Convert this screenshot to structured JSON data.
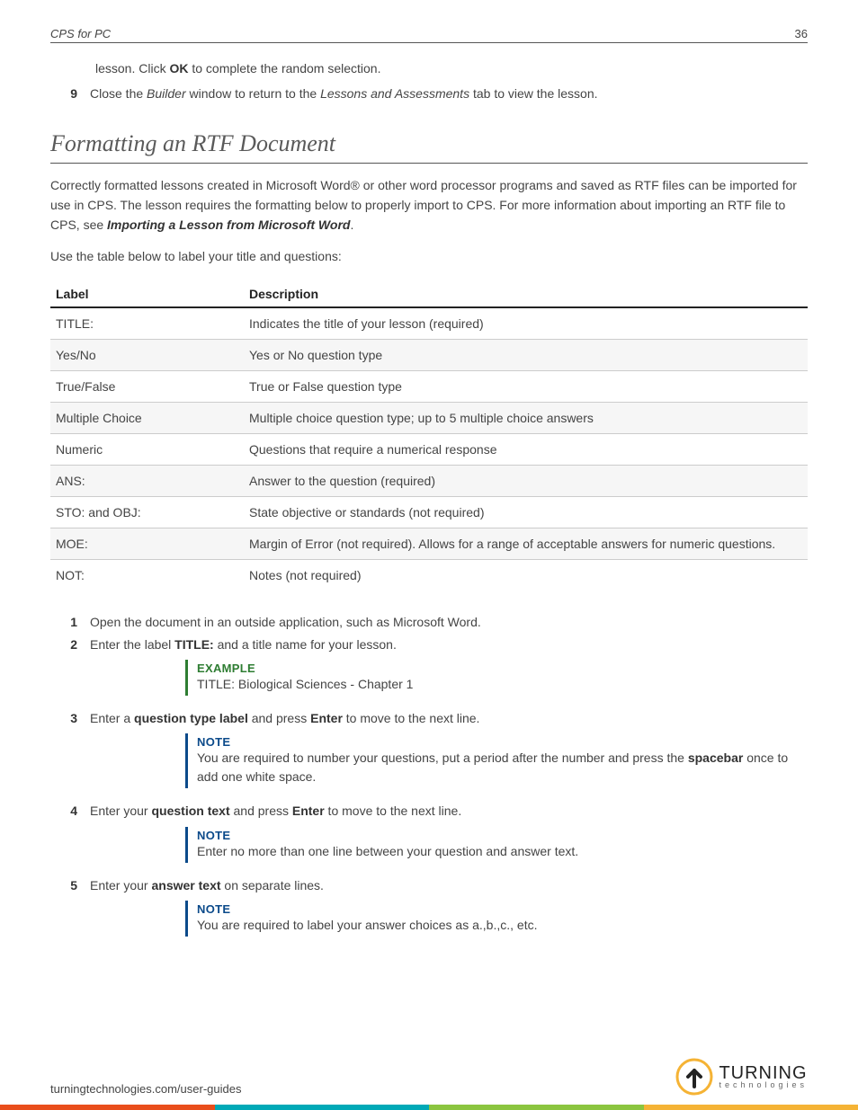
{
  "header": {
    "title": "CPS for PC",
    "page": "36"
  },
  "intro": {
    "cont_line": "lesson. Click <b>OK</b> to complete the random selection.",
    "step9_num": "9",
    "step9_body": "Close the <em class=\"i\">Builder</em> window to return to the <em class=\"i\">Lessons and Assessments</em> tab to view the lesson."
  },
  "section": {
    "heading": "Formatting an RTF Document",
    "p1": "Correctly formatted lessons created in Microsoft Word® or other word processor programs and saved as RTF files can be imported for use in CPS. The lesson requires the formatting below to properly import to CPS. For more information about importing an RTF file to CPS, see <b><em class=\"i\">Importing a Lesson from Microsoft Word</em></b>.",
    "p2": "Use the table below to label your title and questions:"
  },
  "table": {
    "head_label": "Label",
    "head_desc": "Description",
    "rows": [
      {
        "label": "TITLE:",
        "desc": "Indicates the title of your lesson (required)"
      },
      {
        "label": "Yes/No",
        "desc": "Yes or No question type"
      },
      {
        "label": "True/False",
        "desc": "True or False question type"
      },
      {
        "label": "Multiple Choice",
        "desc": "Multiple choice question type; up to 5 multiple choice answers"
      },
      {
        "label": "Numeric",
        "desc": "Questions that require a numerical response"
      },
      {
        "label": "ANS:",
        "desc": "Answer to the question (required)"
      },
      {
        "label": "STO: and OBJ:",
        "desc": "State objective or standards (not required)"
      },
      {
        "label": "MOE:",
        "desc": "Margin of Error (not required). Allows for a range of acceptable answers for numeric questions."
      },
      {
        "label": "NOT:",
        "desc": "Notes (not required)"
      }
    ]
  },
  "steps": [
    {
      "num": "1",
      "body": "Open the document in an outside application, such as Microsoft Word."
    },
    {
      "num": "2",
      "body": "Enter the label <b>TITLE:</b> and a title name for your lesson.",
      "callout": {
        "type": "example",
        "head": "EXAMPLE",
        "body": "TITLE: Biological Sciences - Chapter 1"
      }
    },
    {
      "num": "3",
      "body": "Enter a <b>question type label</b> and press <b>Enter</b> to move to the next line.",
      "callout": {
        "type": "note",
        "head": "NOTE",
        "body": "You are required to number your questions, put a period after the number and press the <b>spacebar</b> once to add one white space."
      }
    },
    {
      "num": "4",
      "body": "Enter your <b>question text</b> and press <b>Enter</b> to move to the next line.",
      "callout": {
        "type": "note",
        "head": "NOTE",
        "body": "Enter no more than one line between your question and answer text."
      }
    },
    {
      "num": "5",
      "body": "Enter your <b>answer text</b> on separate lines.",
      "callout": {
        "type": "note",
        "head": "NOTE",
        "body": "You are required to label your answer choices as a.,b.,c., etc."
      }
    }
  ],
  "footer": {
    "link": "turningtechnologies.com/user-guides",
    "logo_top": "TURNING",
    "logo_bottom": "technologies"
  }
}
